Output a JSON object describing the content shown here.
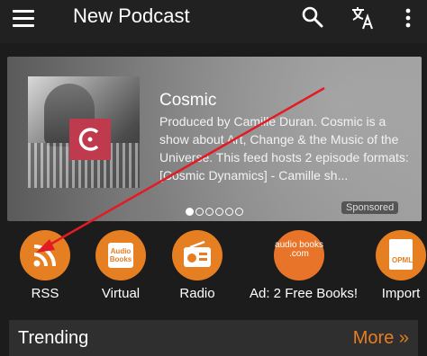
{
  "app_bar": {
    "title": "New Podcast",
    "icons": [
      "menu-icon",
      "search-icon",
      "translate-icon",
      "more-vertical-icon"
    ]
  },
  "featured": {
    "title": "Cosmic",
    "description": "Produced by Camille Duran. Cosmic is a show about Art, Change & the Music of the Universe. This feed hosts 2 episode formats: [Cosmic Dynamics] - Camille sh...",
    "sponsored_label": "Sponsored",
    "page_dots": 6,
    "active_dot": 0,
    "art_logo_letter": "C"
  },
  "categories": [
    {
      "label": "RSS",
      "icon": "rss-icon"
    },
    {
      "label": "Virtual",
      "icon": "audio-books-icon",
      "icon_text": "Audio Books"
    },
    {
      "label": "Radio",
      "icon": "radio-icon"
    },
    {
      "label": "Ad: 2 Free Books!",
      "icon": "audiobooks-com-logo",
      "icon_text": "audio books .com"
    },
    {
      "label": "Import",
      "icon": "opml-icon",
      "icon_text": "OPML"
    }
  ],
  "trending": {
    "title": "Trending",
    "more_label": "More »"
  },
  "colors": {
    "accent": "#e67e22",
    "background": "#1c1c1c",
    "app_bar": "#212121",
    "annotation_arrow": "#e31b23"
  }
}
